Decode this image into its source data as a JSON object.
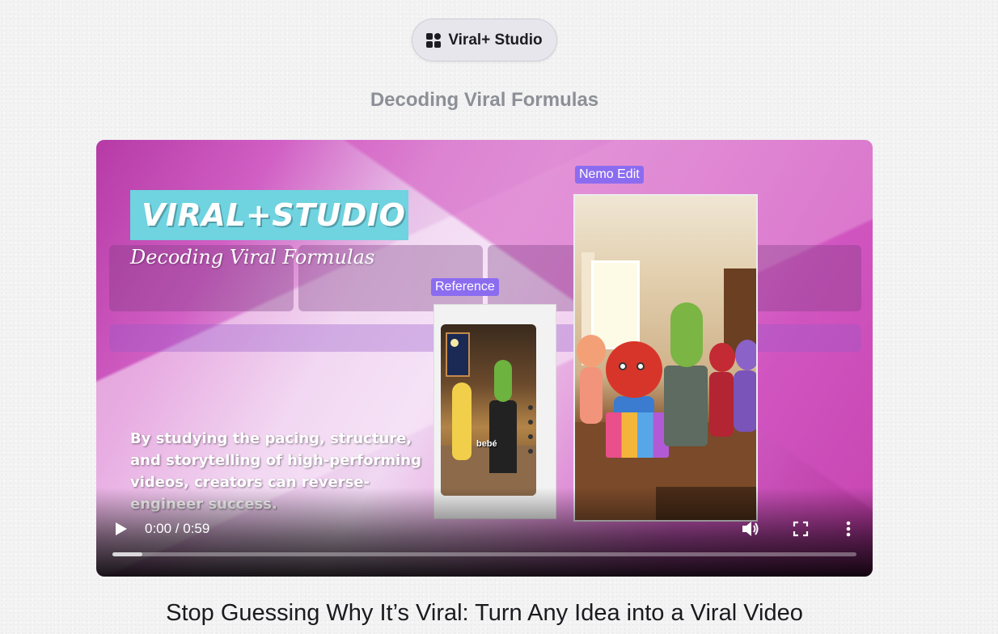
{
  "badge": {
    "label": "Viral+ Studio",
    "icon": "grid-apps-icon"
  },
  "subtitle": "Decoding Viral Formulas",
  "video": {
    "logo_title": "VIRAL+STUDIO",
    "logo_subtitle": "Decoding Viral Formulas",
    "body_text": "By studying the pacing, structure, and storytelling of high-performing videos, creators can reverse-engineer success.",
    "tag_reference": "Reference",
    "tag_nemo": "Nemo Edit",
    "ref_caption": "bebé",
    "controls": {
      "time": "0:00 / 0:59",
      "play_icon": "play-icon",
      "volume_icon": "volume-icon",
      "fullscreen_icon": "fullscreen-icon",
      "more_icon": "more-vertical-icon"
    },
    "progress_buffered": 0.04
  },
  "headline": "Stop Guessing Why It’s Viral: Turn Any Idea into a Viral Video",
  "colors": {
    "accent": "#8b6cf0",
    "logo_bg": "#6fd3e0",
    "magenta": "#c94bb8"
  }
}
